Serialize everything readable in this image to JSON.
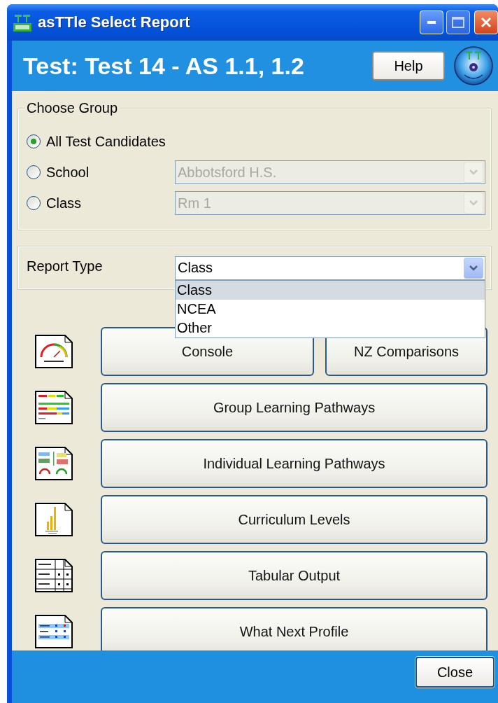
{
  "window": {
    "title": "asTTle Select Report"
  },
  "header": {
    "title": "Test: Test 14 - AS 1.1, 1.2",
    "help_button": "Help"
  },
  "choose_group": {
    "legend": "Choose Group",
    "options": [
      {
        "label": "All Test Candidates",
        "selected": true
      },
      {
        "label": "School",
        "selected": false,
        "combo": {
          "value": "Abbotsford H.S.",
          "disabled": true
        }
      },
      {
        "label": "Class",
        "selected": false,
        "combo": {
          "value": "Rm 1",
          "disabled": true
        }
      }
    ]
  },
  "report_type": {
    "label": "Report Type",
    "value": "Class",
    "dropdown": {
      "expanded": true,
      "items": [
        {
          "label": "Class",
          "selected": true
        },
        {
          "label": "NCEA",
          "selected": false
        },
        {
          "label": "Other",
          "selected": false
        }
      ]
    }
  },
  "reports": [
    {
      "buttons": [
        "Console",
        "NZ Comparisons"
      ]
    },
    {
      "buttons": [
        "Group Learning Pathways"
      ]
    },
    {
      "buttons": [
        "Individual Learning Pathways"
      ]
    },
    {
      "buttons": [
        "Curriculum Levels"
      ]
    },
    {
      "buttons": [
        "Tabular Output"
      ]
    },
    {
      "buttons": [
        "What Next Profile"
      ]
    }
  ],
  "footer": {
    "close_button": "Close"
  }
}
